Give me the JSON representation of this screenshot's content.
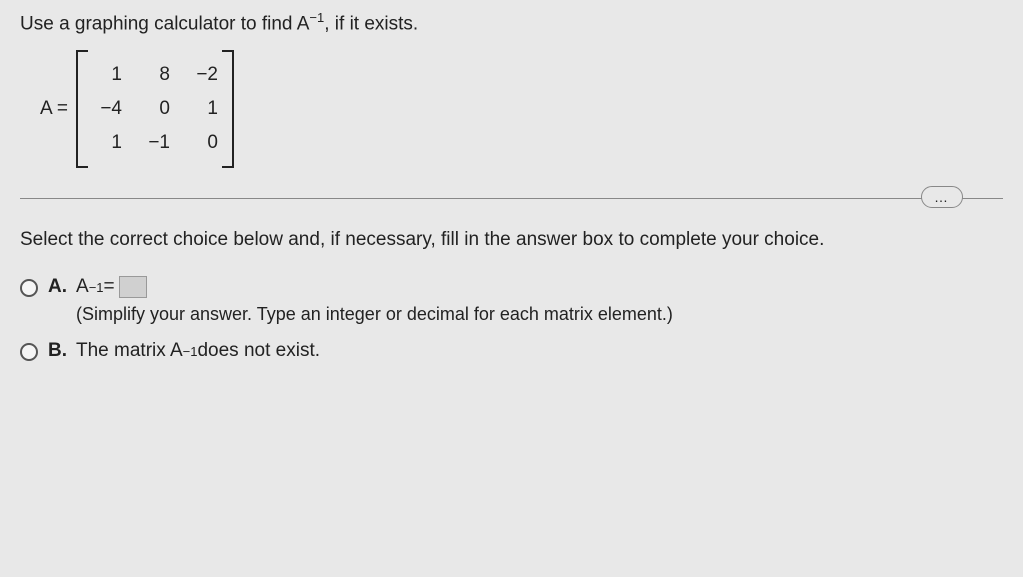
{
  "question": {
    "prefix": "Use a graphing calculator to find A",
    "exponent": "−1",
    "suffix": ", if it exists."
  },
  "matrix": {
    "label": "A =",
    "rows": [
      [
        "1",
        "8",
        "−2"
      ],
      [
        "−4",
        "0",
        "1"
      ],
      [
        "1",
        "−1",
        "0"
      ]
    ]
  },
  "ellipsis": "…",
  "instruction": "Select the correct choice below and, if necessary, fill in the answer box to complete your choice.",
  "choices": {
    "a": {
      "letter": "A.",
      "prefix": "A",
      "exponent": "−1",
      "equals": " = ",
      "hint": "(Simplify your answer. Type an integer or decimal for each matrix element.)"
    },
    "b": {
      "letter": "B.",
      "prefix": "The matrix A",
      "exponent": "−1",
      "suffix": " does not exist."
    }
  }
}
